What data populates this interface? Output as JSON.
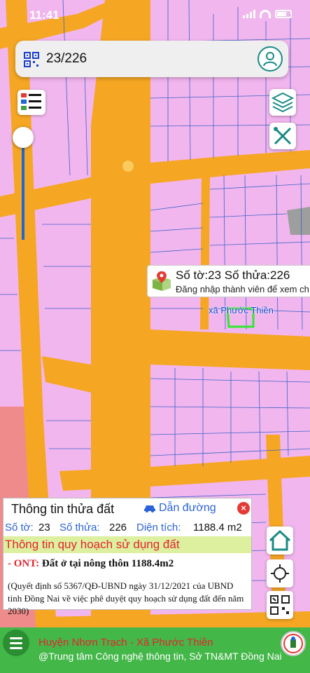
{
  "status": {
    "time": "11:41"
  },
  "search": {
    "value": "23/226"
  },
  "popup": {
    "title": "Số tờ:23 Số thửa:226",
    "subtitle": "Đăng nhập thành viên để xem ch"
  },
  "map": {
    "commune_label": "xã Phước Thiền"
  },
  "info_panel": {
    "title": "Thông tin thửa đất",
    "directions": "Dẫn đường",
    "sheet_label": "Số tờ:",
    "sheet_value": "23",
    "parcel_label": "Số thửa:",
    "parcel_value": "226",
    "area_label": "Diện tích:",
    "area_value": "1188.4 m2",
    "planning_header": "Thông tin quy hoạch sử dụng đất",
    "land_code": "- ONT:",
    "land_desc": "Đất ở tại nông thôn 1188.4m2",
    "decision_note": "(Quyết định số 5367/QĐ-UBND ngày 31/12/2021 của UBND tỉnh Đồng Nai về việc phê duyệt quy hoạch sử dụng đất đến năm 2030)"
  },
  "footer": {
    "line1": "Huyện Nhơn Trạch - Xã Phước Thiền",
    "line2": "@Trung tâm Công nghệ thông tin, Sở TN&MT Đồng Nai"
  },
  "colors": {
    "map_background": "#f2b6ee",
    "road": "#f5a623",
    "parcel_line": "#3b63c9",
    "footer": "#44b749",
    "accent_red": "#e5242d",
    "link_blue": "#2a62d8"
  },
  "icons": [
    "qr-code-icon",
    "user-icon",
    "legend-list-icon",
    "layers-icon",
    "tools-icon",
    "map-pin-icon",
    "car-icon",
    "close-icon",
    "home-icon",
    "crosshair-icon",
    "qr-scan-icon",
    "menu-icon",
    "logo-icon"
  ]
}
